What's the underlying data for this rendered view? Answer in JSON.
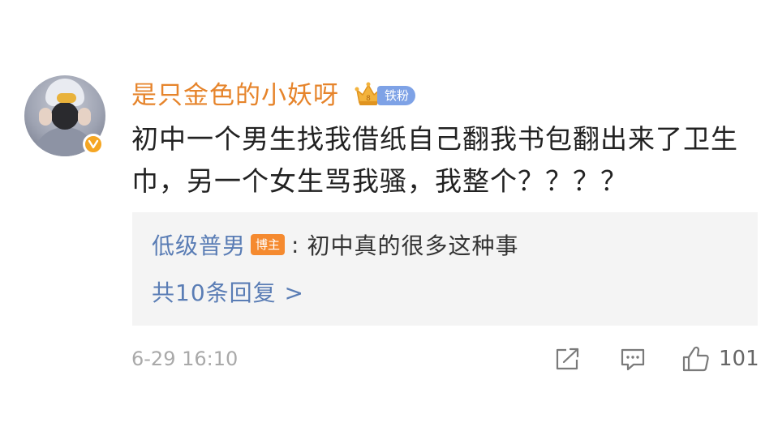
{
  "comment": {
    "username": "是只金色的小妖呀",
    "fan_badge": "铁粉",
    "text": "初中一个男生找我借纸自己翻我书包翻出来了卫生巾，另一个女生骂我骚，我整个？？？？",
    "timestamp": "6-29 16:10"
  },
  "reply": {
    "author": "低级普男",
    "host_badge": "博主",
    "colon": ":",
    "text": "初中真的很多这种事",
    "view_all": "共10条回复 >"
  },
  "actions": {
    "share_icon": "share-icon",
    "comment_icon": "comment-icon",
    "like_icon": "thumbs-up-icon",
    "like_count": "101"
  },
  "colors": {
    "username": "#e6842b",
    "fan_badge": "#7ea2e6",
    "host_badge": "#f58a2f",
    "link": "#5a7db5",
    "reply_bg": "#f4f4f4"
  }
}
